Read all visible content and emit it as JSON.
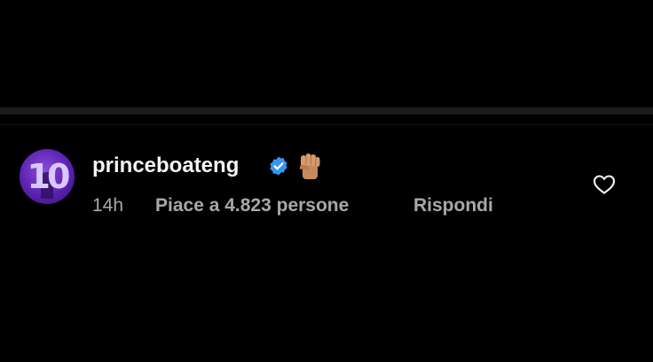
{
  "comment": {
    "username": "princeboateng",
    "avatar_text": "10",
    "verified_icon": "verified-badge-icon",
    "emoji": "raised-fist-icon",
    "timestamp": "14h",
    "likes_label": "Piace a 4.823 persone",
    "reply_label": "Rispondi",
    "like_icon": "heart-outline-icon"
  },
  "colors": {
    "background": "#000000",
    "username": "#f5f5f5",
    "meta_text": "#a8a8a8",
    "verified_blue": "#3797f0",
    "avatar_purple": "#5b22b0"
  }
}
